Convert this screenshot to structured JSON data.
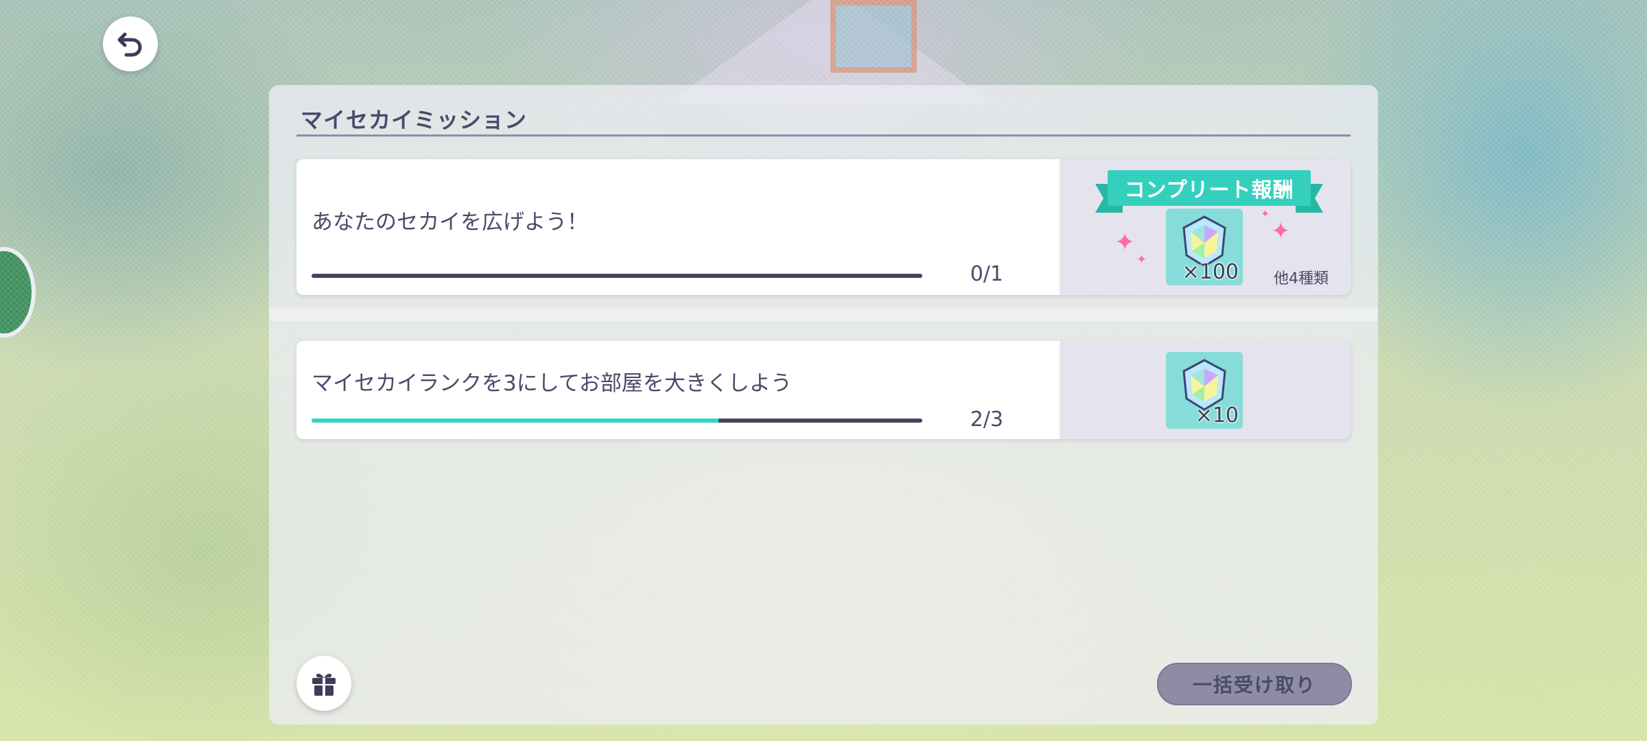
{
  "panel": {
    "title": "マイセカイミッション"
  },
  "missions": [
    {
      "text": "あなたのセカイを広げよう！",
      "progress_text": "0/1",
      "progress_fraction": 0.0,
      "complete_reward_label": "コンプリート報酬",
      "reward_count": "×100",
      "extra_rewards": "他4種類",
      "reward_icon": "crystal-gem-icon"
    },
    {
      "text": "マイセカイランクを3にしてお部屋を大きくしよう",
      "progress_text": "2/3",
      "progress_fraction": 0.6667,
      "reward_count": "×10",
      "reward_icon": "crystal-gem-icon"
    }
  ],
  "buttons": {
    "claim_all_label": "一括受け取り",
    "back_icon": "back-arrow-icon",
    "gift_icon": "gift-icon"
  },
  "colors": {
    "progress_fill": "#33d6c0",
    "progress_track": "#45455f",
    "ribbon": "#35d0bd",
    "text": "#4a4a6a"
  }
}
